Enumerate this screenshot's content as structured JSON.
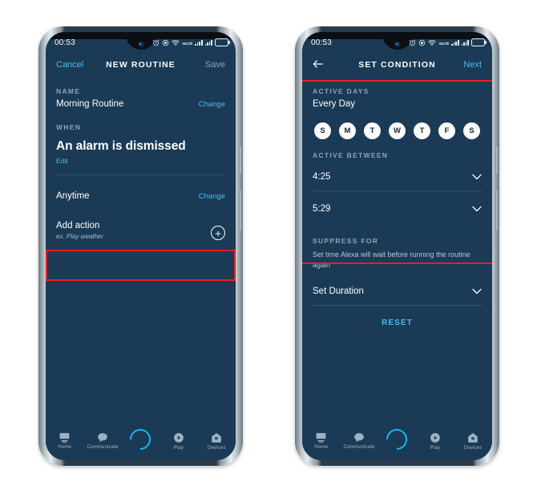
{
  "statusbar": {
    "time": "00:53",
    "icons": [
      "alarm-icon",
      "location-icon",
      "wifi-icon",
      "volte-icon",
      "signal-icon-1",
      "signal-icon-2",
      "battery-icon"
    ],
    "volte_label": "VoLTE",
    "battery_label": ""
  },
  "left_phone": {
    "appbar": {
      "cancel_label": "Cancel",
      "title": "NEW ROUTINE",
      "save_label": "Save"
    },
    "name_section": {
      "label": "NAME",
      "value": "Morning Routine",
      "change_label": "Change"
    },
    "when_section": {
      "label": "WHEN",
      "value": "An alarm is dismissed",
      "edit_label": "Edit"
    },
    "anytime_row": {
      "value": "Anytime",
      "change_label": "Change"
    },
    "add_action": {
      "title": "Add action",
      "subtitle": "ex. Play weather",
      "plus_label": "+"
    }
  },
  "right_phone": {
    "appbar": {
      "back_label": "←",
      "title": "SET CONDITION",
      "next_label": "Next"
    },
    "active_days": {
      "label": "ACTIVE DAYS",
      "value": "Every Day",
      "days": [
        {
          "letter": "S",
          "name": "sunday",
          "selected": true
        },
        {
          "letter": "M",
          "name": "monday",
          "selected": true
        },
        {
          "letter": "T",
          "name": "tuesday",
          "selected": true
        },
        {
          "letter": "W",
          "name": "wednesday",
          "selected": true
        },
        {
          "letter": "T",
          "name": "thursday",
          "selected": true
        },
        {
          "letter": "F",
          "name": "friday",
          "selected": true
        },
        {
          "letter": "S",
          "name": "saturday",
          "selected": true
        }
      ]
    },
    "active_between": {
      "label": "ACTIVE BETWEEN",
      "start_time": "4:25",
      "end_time": "5:29"
    },
    "suppress_for": {
      "label": "SUPPRESS FOR",
      "help": "Set time Alexa will wait before running the routine again",
      "duration_label": "Set Duration"
    },
    "reset_label": "RESET"
  },
  "bottomnav": {
    "items": [
      {
        "label": "Home",
        "icon": "display-icon"
      },
      {
        "label": "Communicate",
        "icon": "chat-bubble-icon"
      },
      {
        "label": "",
        "icon": "alexa-ring-icon"
      },
      {
        "label": "Play",
        "icon": "play-circle-icon"
      },
      {
        "label": "Devices",
        "icon": "home-devices-icon"
      }
    ]
  },
  "colors": {
    "screen_bg": "#1a3a56",
    "accent_link": "#4cb9f0",
    "highlight_box": "#ee1c23",
    "muted_text": "#8aa6bd",
    "alexa_ring": "#12b8f0"
  }
}
